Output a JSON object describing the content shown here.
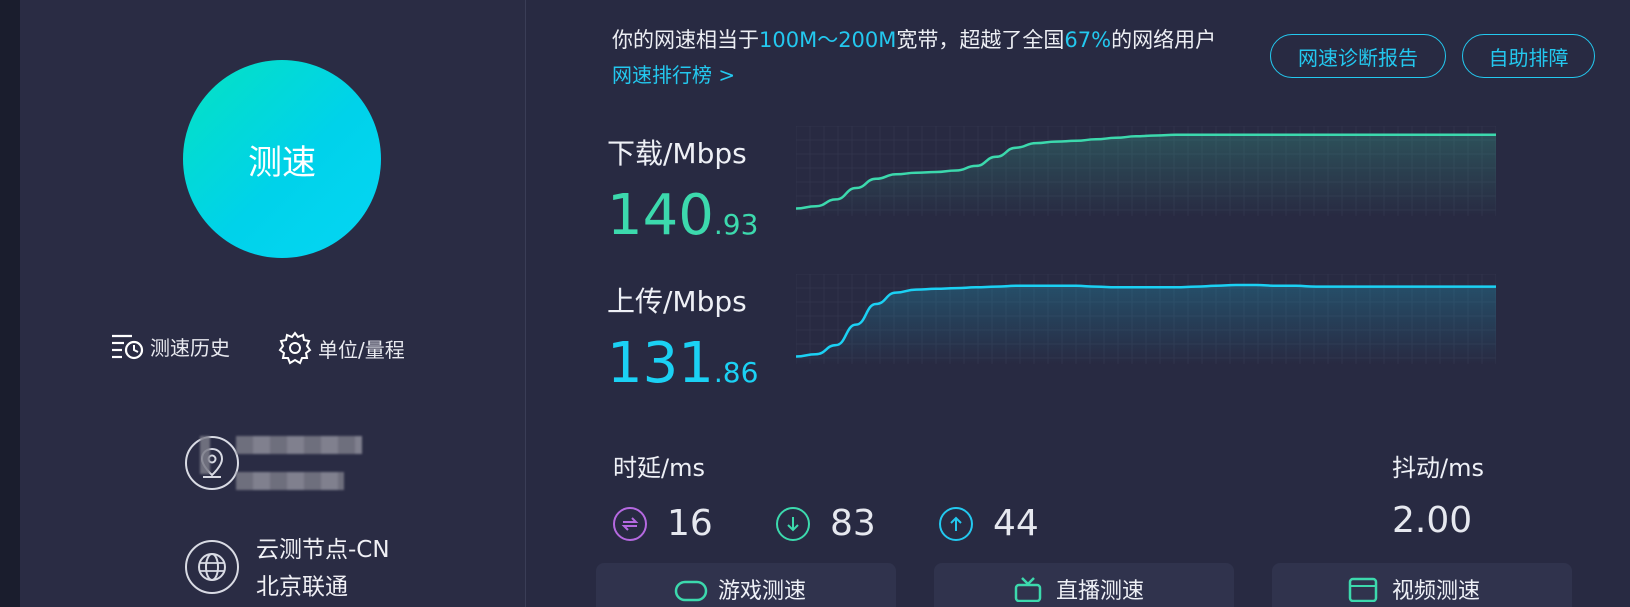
{
  "sidebar": {
    "speed_button": "测速",
    "history_label": "测速历史",
    "units_label": "单位/量程",
    "node": {
      "name": "云测节点-CN",
      "isp": "北京联通"
    }
  },
  "summary": {
    "prefix": "你的网速相当于",
    "bandwidth": "100M～200M",
    "middle": "宽带，超越了全国",
    "percent": "67%",
    "suffix": "的网络用户",
    "rank_link": "网速排行榜 >"
  },
  "actions": {
    "report": "网速诊断报告",
    "troubleshoot": "自助排障"
  },
  "download": {
    "label": "下载/Mbps",
    "int": "140",
    "dec": ".93",
    "color": "#3cd9ad"
  },
  "upload": {
    "label": "上传/Mbps",
    "int": "131",
    "dec": ".86",
    "color": "#1bd1f4"
  },
  "latency": {
    "label": "时延/ms",
    "idle": "16",
    "down": "83",
    "up": "44",
    "colors": {
      "idle": "#b569e0",
      "down": "#3cd9ad",
      "up": "#23c8ef"
    }
  },
  "jitter": {
    "label": "抖动/ms",
    "value": "2.00"
  },
  "cards": {
    "game": "游戏测速",
    "live": "直播测速",
    "video": "视频测速"
  },
  "chart_data": [
    {
      "type": "area",
      "series": [
        {
          "values": [
            0.02,
            0.05,
            0.14,
            0.29,
            0.41,
            0.47,
            0.49,
            0.5,
            0.52,
            0.58,
            0.7,
            0.82,
            0.88,
            0.9,
            0.91,
            0.93,
            0.95,
            0.97,
            0.98,
            0.99,
            0.99,
            0.99,
            0.99,
            0.99,
            0.99,
            0.99,
            0.99,
            0.99,
            0.99,
            0.99,
            0.99,
            0.99,
            0.99,
            0.99,
            0.99,
            0.99
          ]
        }
      ],
      "grid": true
    },
    {
      "type": "area",
      "series": [
        {
          "values": [
            0.02,
            0.05,
            0.17,
            0.44,
            0.71,
            0.86,
            0.9,
            0.91,
            0.92,
            0.93,
            0.94,
            0.95,
            0.95,
            0.95,
            0.95,
            0.94,
            0.93,
            0.93,
            0.93,
            0.93,
            0.94,
            0.95,
            0.96,
            0.96,
            0.95,
            0.95,
            0.94,
            0.94,
            0.94,
            0.94,
            0.94,
            0.94,
            0.94,
            0.94,
            0.94,
            0.94
          ]
        }
      ],
      "grid": true
    }
  ]
}
